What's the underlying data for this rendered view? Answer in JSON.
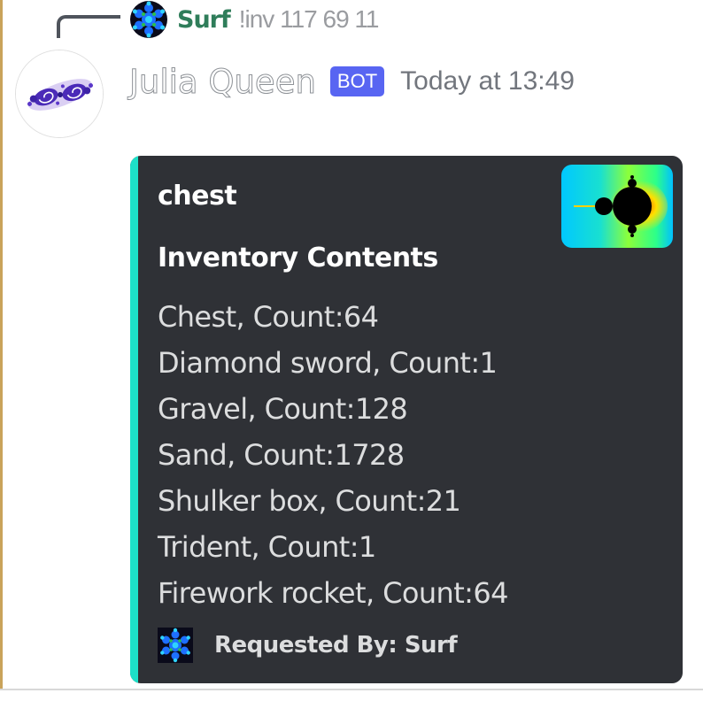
{
  "reply": {
    "author": "Surf",
    "command": "!inv 117 69 11",
    "avatar_icon": "blue-snowflake-fractal-icon"
  },
  "message": {
    "author": "Julia Queen",
    "bot_tag": "BOT",
    "timestamp": "Today at 13:49",
    "avatar_icon": "julia-set-fractal-icon"
  },
  "embed": {
    "accent_color": "#1de0c8",
    "thumbnail_icon": "mandelbrot-fractal-icon",
    "title": "chest",
    "field_name": "Inventory Contents",
    "items": [
      "Chest, Count:64",
      "Diamond sword, Count:1",
      "Gravel, Count:128",
      "Sand, Count:1728",
      "Shulker box, Count:21",
      "Trident, Count:1",
      "Firework rocket, Count:64"
    ],
    "footer_text": "Requested By: Surf",
    "footer_icon": "blue-snowflake-fractal-icon"
  }
}
